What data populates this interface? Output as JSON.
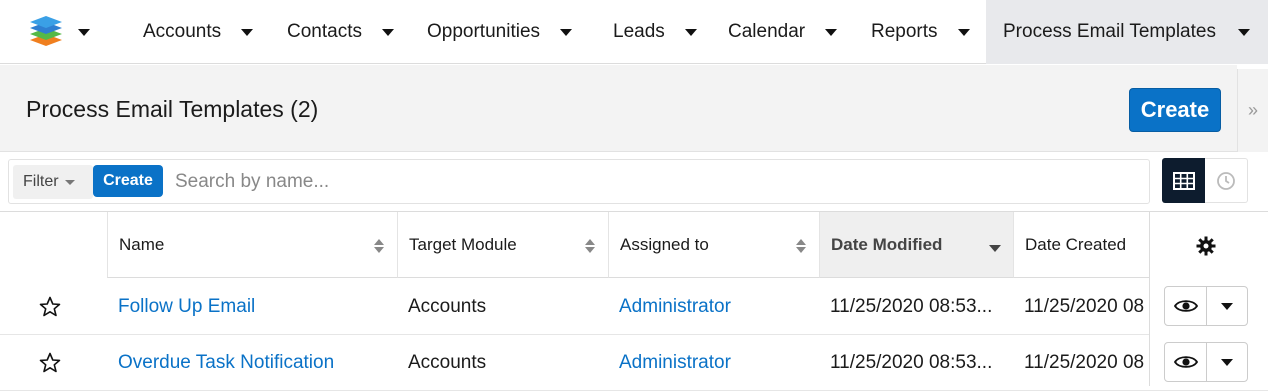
{
  "nav": {
    "items": [
      {
        "label": "Accounts"
      },
      {
        "label": "Contacts"
      },
      {
        "label": "Opportunities"
      },
      {
        "label": "Leads"
      },
      {
        "label": "Calendar"
      },
      {
        "label": "Reports"
      },
      {
        "label": "Process Email Templates",
        "active": true
      }
    ],
    "logo_icon": "layered-cube-logo-icon"
  },
  "header": {
    "title": "Process Email Templates (2)",
    "create_label": "Create",
    "toggle_icon": "double-chevron-right-icon"
  },
  "filter": {
    "filter_label": "Filter",
    "create_label": "Create",
    "search_placeholder": "Search by name...",
    "view_icons": [
      "grid-view-icon",
      "clock-icon"
    ]
  },
  "table": {
    "columns": [
      {
        "label": "Name"
      },
      {
        "label": "Target Module"
      },
      {
        "label": "Assigned to"
      },
      {
        "label": "Date Modified",
        "sorted": "desc"
      },
      {
        "label": "Date Created"
      }
    ],
    "rows": [
      {
        "name": "Follow Up Email",
        "target_module": "Accounts",
        "assigned_to": "Administrator",
        "date_modified": "11/25/2020 08:53...",
        "date_created": "11/25/2020 08"
      },
      {
        "name": "Overdue Task Notification",
        "target_module": "Accounts",
        "assigned_to": "Administrator",
        "date_modified": "11/25/2020 08:53...",
        "date_created": "11/25/2020 08"
      }
    ]
  },
  "colors": {
    "accent": "#0a72c7",
    "dark": "#0d1c2e",
    "active_tab": "#e8e9ec"
  }
}
